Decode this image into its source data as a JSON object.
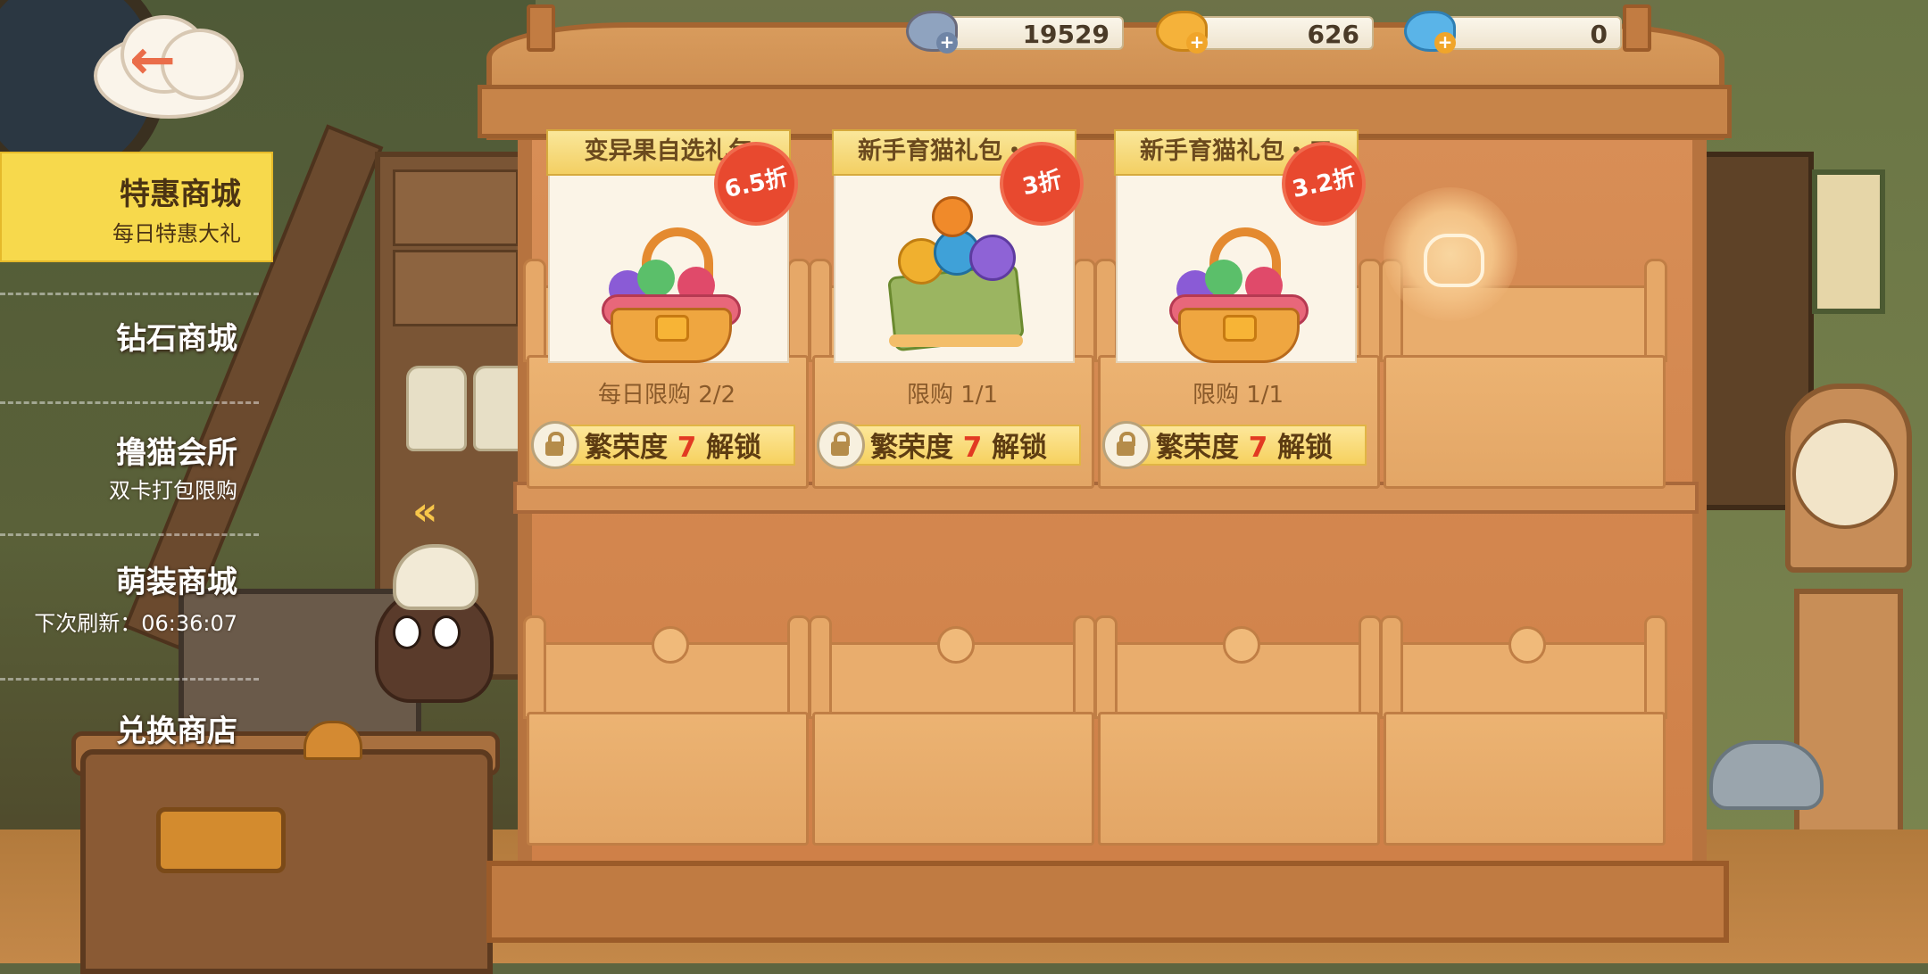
{
  "currencies": [
    {
      "icon": "silver-fish-icon",
      "value": "19529",
      "color": "#8fa3bf"
    },
    {
      "icon": "gold-fish-icon",
      "value": "626",
      "color": "#f5b23a"
    },
    {
      "icon": "blue-fish-icon",
      "value": "0",
      "color": "#5ab4e8"
    }
  ],
  "back_button": {
    "icon": "back-arrow-icon",
    "label": "←"
  },
  "sidebar": {
    "items": [
      {
        "title": "特惠商城",
        "subtitle": "每日特惠大礼",
        "active": true
      },
      {
        "title": "钻石商城",
        "subtitle": "",
        "active": false
      },
      {
        "title": "撸猫会所",
        "subtitle": "双卡打包限购",
        "active": false
      },
      {
        "title": "萌装商城",
        "subtitle": "下次刷新：06:36:07",
        "active": false
      },
      {
        "title": "兑换商店",
        "subtitle": "",
        "active": false
      }
    ]
  },
  "scroll_hint": "«",
  "shelf": {
    "items": [
      {
        "title": "变异果自选礼包",
        "discount": "6.5折",
        "limit": "每日限购 2/2",
        "unlock_prefix": "繁荣度",
        "unlock_level": "7",
        "unlock_suffix": "解锁",
        "image": "fruit-basket"
      },
      {
        "title": "新手育猫礼包・一",
        "discount": "3折",
        "limit": "限购 1/1",
        "unlock_prefix": "繁荣度",
        "unlock_level": "7",
        "unlock_suffix": "解锁",
        "image": "cat-fruit-box"
      },
      {
        "title": "新手育猫礼包・二",
        "discount": "3.2折",
        "limit": "限购 1/1",
        "unlock_prefix": "繁荣度",
        "unlock_level": "7",
        "unlock_suffix": "解锁",
        "image": "fruit-basket"
      }
    ]
  },
  "colors": {
    "accent_yellow": "#f7d94c",
    "discount_red": "#e8492f",
    "wood": "#d88e56"
  }
}
